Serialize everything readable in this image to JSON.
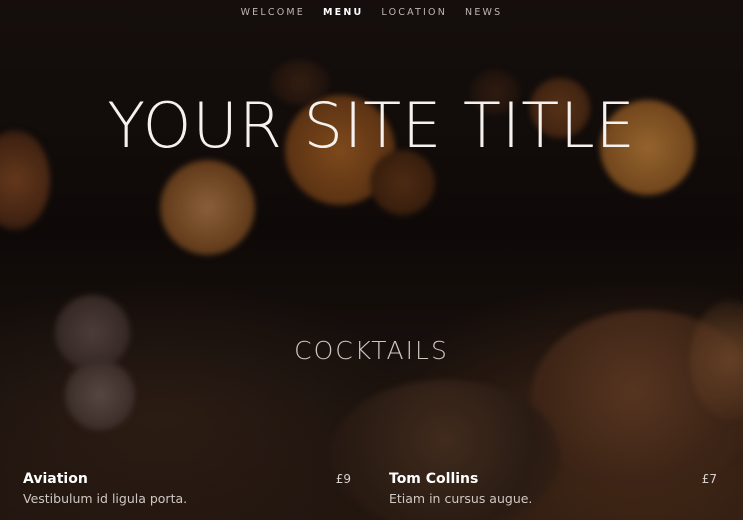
{
  "nav": {
    "items": [
      {
        "label": "WELCOME"
      },
      {
        "label": "MENU"
      },
      {
        "label": "LOCATION"
      },
      {
        "label": "NEWS"
      }
    ],
    "active": "MENU"
  },
  "hero": {
    "title": "YOUR SITE TITLE"
  },
  "section": {
    "heading": "COCKTAILS"
  },
  "menu": {
    "items": [
      {
        "name": "Aviation",
        "price": "£9",
        "description": "Vestibulum id ligula porta."
      },
      {
        "name": "Tom Collins",
        "price": "£7",
        "description": "Etiam in cursus augue."
      }
    ]
  },
  "colors": {
    "background": "#150f0c",
    "text": "#ffffff",
    "nav_text": "#bdb6b1",
    "bokeh_orange": "#c8742a"
  }
}
